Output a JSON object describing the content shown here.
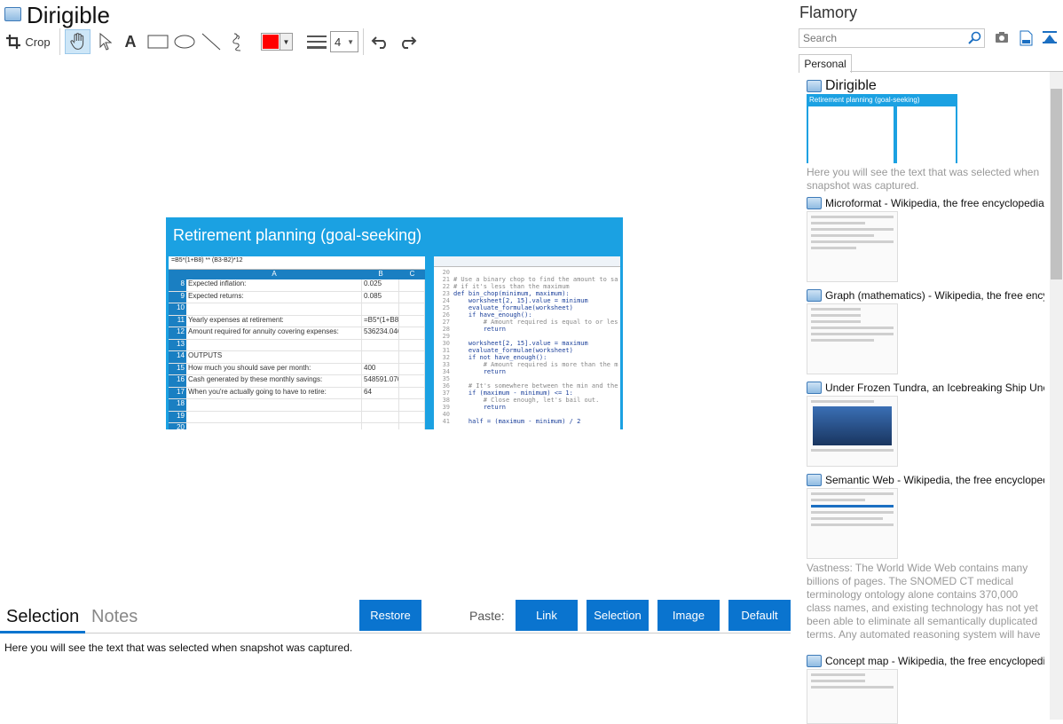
{
  "app": {
    "title": "Dirigible"
  },
  "toolbar": {
    "crop_label": "Crop",
    "text_tool": "A",
    "width_value": "4",
    "color": "#ff0000"
  },
  "preview": {
    "title": "Retirement planning (goal-seeking)",
    "formula": "=B5*(1+B8) ** (B3-B2)*12",
    "col_headers": [
      "A",
      "B",
      "C"
    ],
    "rows": [
      {
        "n": "8",
        "a": "Expected inflation:",
        "b": "0.025"
      },
      {
        "n": "9",
        "a": "Expected returns:",
        "b": "0.085"
      },
      {
        "n": "10",
        "a": "",
        "b": ""
      },
      {
        "n": "11",
        "a": "Yearly expenses at retirement:",
        "b": "=B5*(1+B8) **"
      },
      {
        "n": "12",
        "a": "Amount required for annuity covering expenses:",
        "b": "536234.046"
      },
      {
        "n": "13",
        "a": "",
        "b": ""
      },
      {
        "n": "14",
        "a": "OUTPUTS",
        "b": ""
      },
      {
        "n": "15",
        "a": "How much you should save per month:",
        "b": "400"
      },
      {
        "n": "16",
        "a": "Cash generated by these monthly savings:",
        "b": "548591.070"
      },
      {
        "n": "17",
        "a": "When you're actually going to have to retire:",
        "b": "64"
      },
      {
        "n": "18",
        "a": "",
        "b": ""
      },
      {
        "n": "19",
        "a": "",
        "b": ""
      },
      {
        "n": "20",
        "a": "",
        "b": ""
      }
    ],
    "code_lines": [
      {
        "n": "20",
        "t": ""
      },
      {
        "n": "21",
        "t": "# Use a binary chop to find the amount to sa"
      },
      {
        "n": "22",
        "t": "# if it's less than the maximum"
      },
      {
        "n": "23",
        "t": "def bin_chop(minimum, maximum):"
      },
      {
        "n": "24",
        "t": "    worksheet[2, 15].value = minimum"
      },
      {
        "n": "25",
        "t": "    evaluate_formulae(worksheet)"
      },
      {
        "n": "26",
        "t": "    if have_enough():"
      },
      {
        "n": "27",
        "t": "        # Amount required is equal to or les"
      },
      {
        "n": "28",
        "t": "        return"
      },
      {
        "n": "29",
        "t": ""
      },
      {
        "n": "30",
        "t": "    worksheet[2, 15].value = maximum"
      },
      {
        "n": "31",
        "t": "    evaluate_formulae(worksheet)"
      },
      {
        "n": "32",
        "t": "    if not have_enough():"
      },
      {
        "n": "33",
        "t": "        # Amount required is more than the m"
      },
      {
        "n": "34",
        "t": "        return"
      },
      {
        "n": "35",
        "t": ""
      },
      {
        "n": "36",
        "t": "    # It's somewhere between the min and the"
      },
      {
        "n": "37",
        "t": "    if (maximum - minimum) <= 1:"
      },
      {
        "n": "38",
        "t": "        # Close enough, let's bail out."
      },
      {
        "n": "39",
        "t": "        return"
      },
      {
        "n": "40",
        "t": ""
      },
      {
        "n": "41",
        "t": "    half = (maximum - minimum) / 2"
      }
    ]
  },
  "bottom": {
    "tab_selection": "Selection",
    "tab_notes": "Notes",
    "restore": "Restore",
    "paste_label": "Paste:",
    "paste_link": "Link",
    "paste_selection": "Selection",
    "paste_image": "Image",
    "paste_default": "Default",
    "selection_text": "Here you will see the text that was selected when snapshot was captured."
  },
  "sidebar": {
    "title": "Flamory",
    "search_placeholder": "Search",
    "tab": "Personal",
    "items": [
      {
        "title": "Dirigible",
        "desc": "Here you will see the text that was selected when snapshot was captured."
      },
      {
        "title": "Microformat - Wikipedia, the free encyclopedia",
        "desc": ""
      },
      {
        "title": "Graph (mathematics) - Wikipedia, the free ency",
        "desc": ""
      },
      {
        "title": "Under Frozen Tundra, an Icebreaking Ship Unco",
        "desc": ""
      },
      {
        "title": "Semantic Web - Wikipedia, the free encycloped",
        "desc": "Vastness: The World Wide Web contains many billions of pages. The SNOMED CT medical terminology ontology alone contains 370,000 class names, and existing technology has not yet been able to eliminate all semantically duplicated terms. Any automated reasoning system will have to deal with truly huge inputs."
      },
      {
        "title": "Concept map - Wikipedia, the free encyclopedia",
        "desc": ""
      }
    ]
  }
}
